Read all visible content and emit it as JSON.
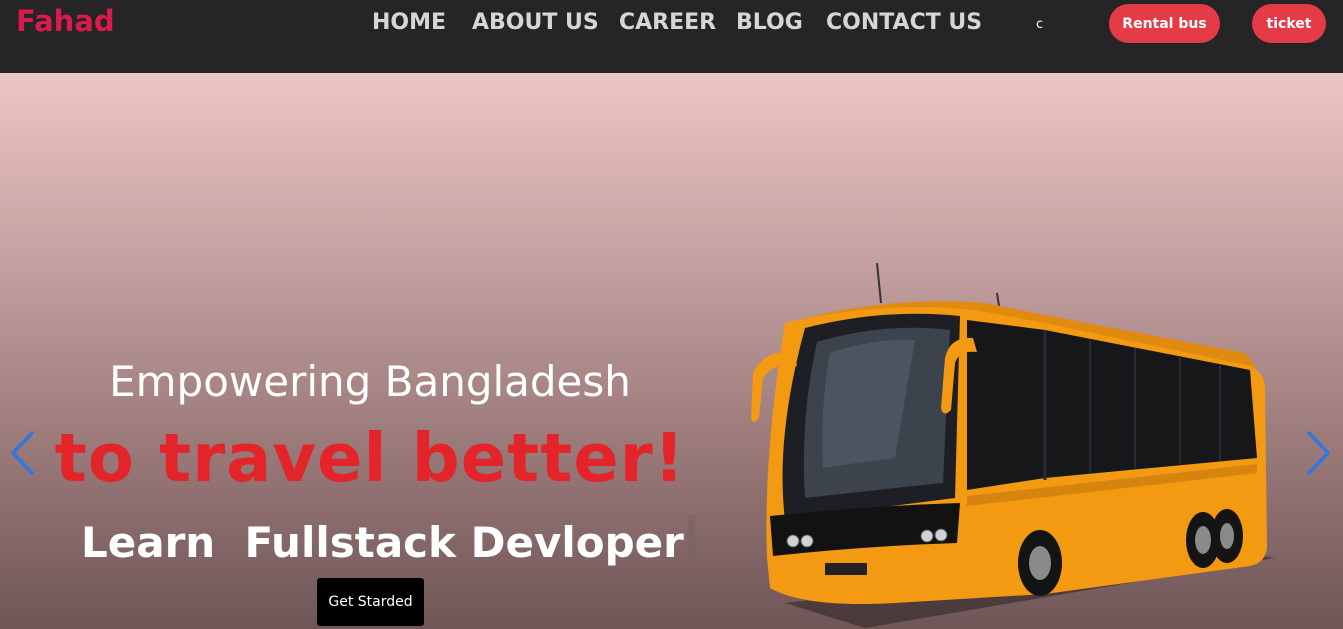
{
  "navbar": {
    "brand": "Fahad",
    "links": [
      "HOME",
      "ABOUT US",
      "CAREER",
      "BLOG",
      "CONTACT US"
    ],
    "extra": "c",
    "buttons": [
      "Rental bus",
      "ticket"
    ]
  },
  "hero": {
    "line1": "Empowering Bangladesh",
    "line2": "to travel better!",
    "line3": "Learn  Fullstack Devloper",
    "cta": "Get Starded",
    "image": "coach-bus-image",
    "prev_icon": "chevron-left-icon",
    "next_icon": "chevron-right-icon"
  },
  "colors": {
    "navbar_bg": "#252427",
    "brand": "#d91a4a",
    "pill_button": "#e43b47",
    "headline_red": "#e32428",
    "carousel_arrow": "#2f78e0",
    "bus_body": "#f39a12"
  }
}
